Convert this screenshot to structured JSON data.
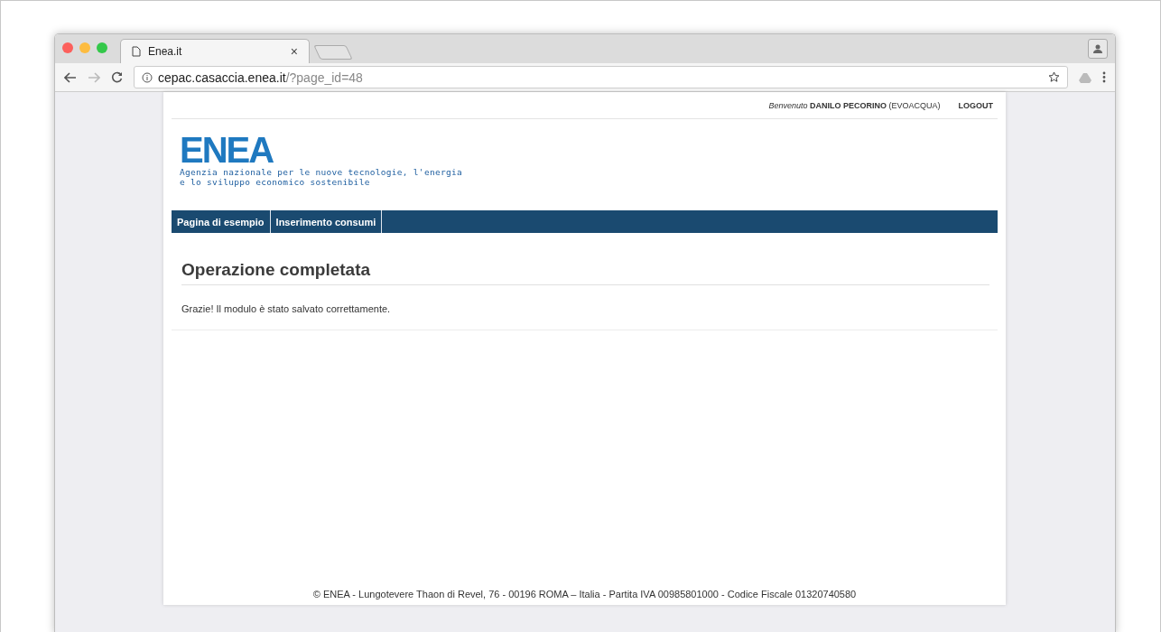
{
  "browser": {
    "tab_title": "Enea.it",
    "tab_close": "×",
    "url_host": "cepac.casaccia.enea.it",
    "url_path": "/?page_id=48"
  },
  "user_bar": {
    "greeting": "Benvenuto",
    "user": "DANILO PECORINO",
    "org": "(EVOACQUA)",
    "logout": "LOGOUT"
  },
  "logo": {
    "mark": "ENEA",
    "tagline_1": "Agenzia nazionale per le nuove tecnologie, l'energia",
    "tagline_2": "e lo sviluppo economico sostenibile"
  },
  "nav": [
    {
      "label": "Pagina di esempio",
      "selected": false
    },
    {
      "label": "Inserimento consumi",
      "selected": false
    }
  ],
  "content": {
    "title": "Operazione completata",
    "message": "Grazie! Il modulo è stato salvato correttamente."
  },
  "footer": "© ENEA - Lungotevere Thaon di Revel, 76 - 00196 ROMA – Italia - Partita IVA 00985801000 - Codice Fiscale 01320740580"
}
